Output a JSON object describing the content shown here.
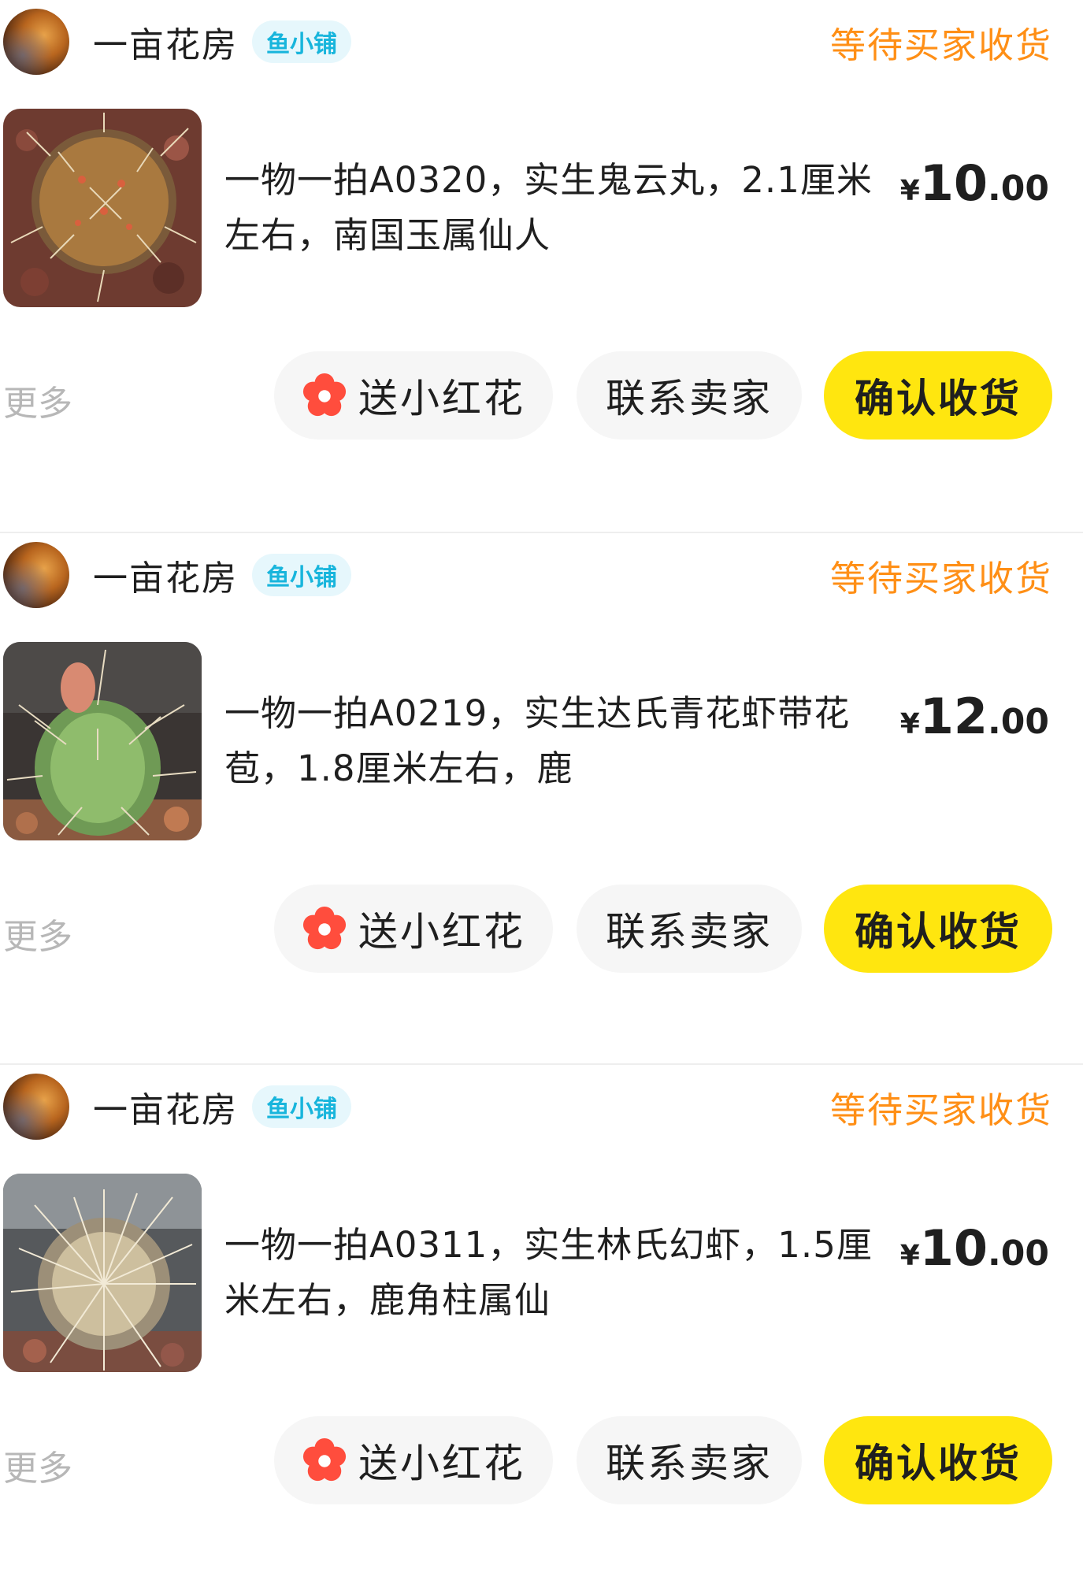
{
  "orders": [
    {
      "shop_name": "一亩花房",
      "shop_badge": "鱼小铺",
      "status": "等待买家收货",
      "item_title": "一物一拍A0320，实生鬼云丸，2.1厘米左右，南国玉属仙人",
      "price_currency": "¥",
      "price_integer": "10",
      "price_decimal": ".00",
      "more_label": "更多",
      "flower_button": "送小红花",
      "contact_button": "联系卖家",
      "confirm_button": "确认收货"
    },
    {
      "shop_name": "一亩花房",
      "shop_badge": "鱼小铺",
      "status": "等待买家收货",
      "item_title": "一物一拍A0219，实生达氏青花虾带花苞，1.8厘米左右，鹿",
      "price_currency": "¥",
      "price_integer": "12",
      "price_decimal": ".00",
      "more_label": "更多",
      "flower_button": "送小红花",
      "contact_button": "联系卖家",
      "confirm_button": "确认收货"
    },
    {
      "shop_name": "一亩花房",
      "shop_badge": "鱼小铺",
      "status": "等待买家收货",
      "item_title": "一物一拍A0311，实生林氏幻虾，1.5厘米左右，鹿角柱属仙",
      "price_currency": "¥",
      "price_integer": "10",
      "price_decimal": ".00",
      "more_label": "更多",
      "flower_button": "送小红花",
      "contact_button": "联系卖家",
      "confirm_button": "确认收货"
    }
  ],
  "colors": {
    "status": "#ff8f16",
    "badge_text": "#18b5dc",
    "badge_bg": "#e6f7fc",
    "confirm_bg": "#ffe60f",
    "secondary_btn_bg": "#f6f6f6",
    "flower": "#ff4d3d",
    "more_text": "#b7b7b7"
  },
  "icons": {
    "avatar": "lion-avatar",
    "flower": "red-flower-icon"
  }
}
